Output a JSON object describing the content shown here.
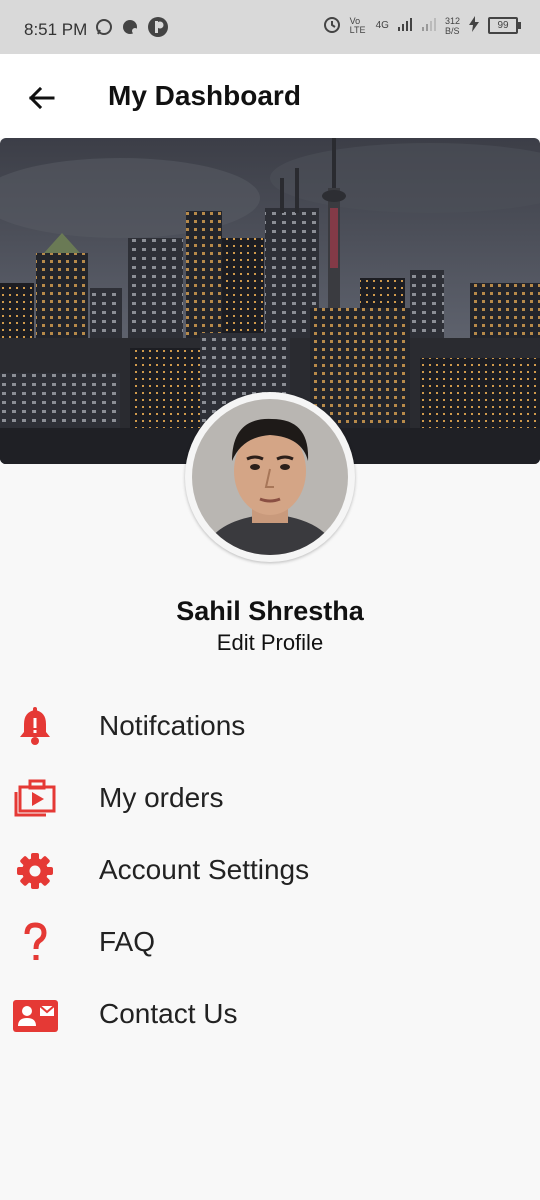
{
  "status_bar": {
    "time": "8:51 PM",
    "network_label": "Vo LTE",
    "network_type": "4G",
    "speed_value": "312",
    "speed_unit": "B/S",
    "battery": "99"
  },
  "header": {
    "title": "My Dashboard"
  },
  "profile": {
    "name": "Sahil Shrestha",
    "edit_label": "Edit Profile"
  },
  "menu": {
    "items": [
      {
        "label": "Notifcations",
        "icon": "bell-icon"
      },
      {
        "label": "My orders",
        "icon": "orders-icon"
      },
      {
        "label": "Account Settings",
        "icon": "gear-icon"
      },
      {
        "label": "FAQ",
        "icon": "question-icon"
      },
      {
        "label": "Contact Us",
        "icon": "contact-card-icon"
      }
    ]
  },
  "colors": {
    "accent": "#e53935",
    "app_bar": "#ffffff",
    "status_bar": "#d9d9d9",
    "background": "#f8f8f8"
  }
}
